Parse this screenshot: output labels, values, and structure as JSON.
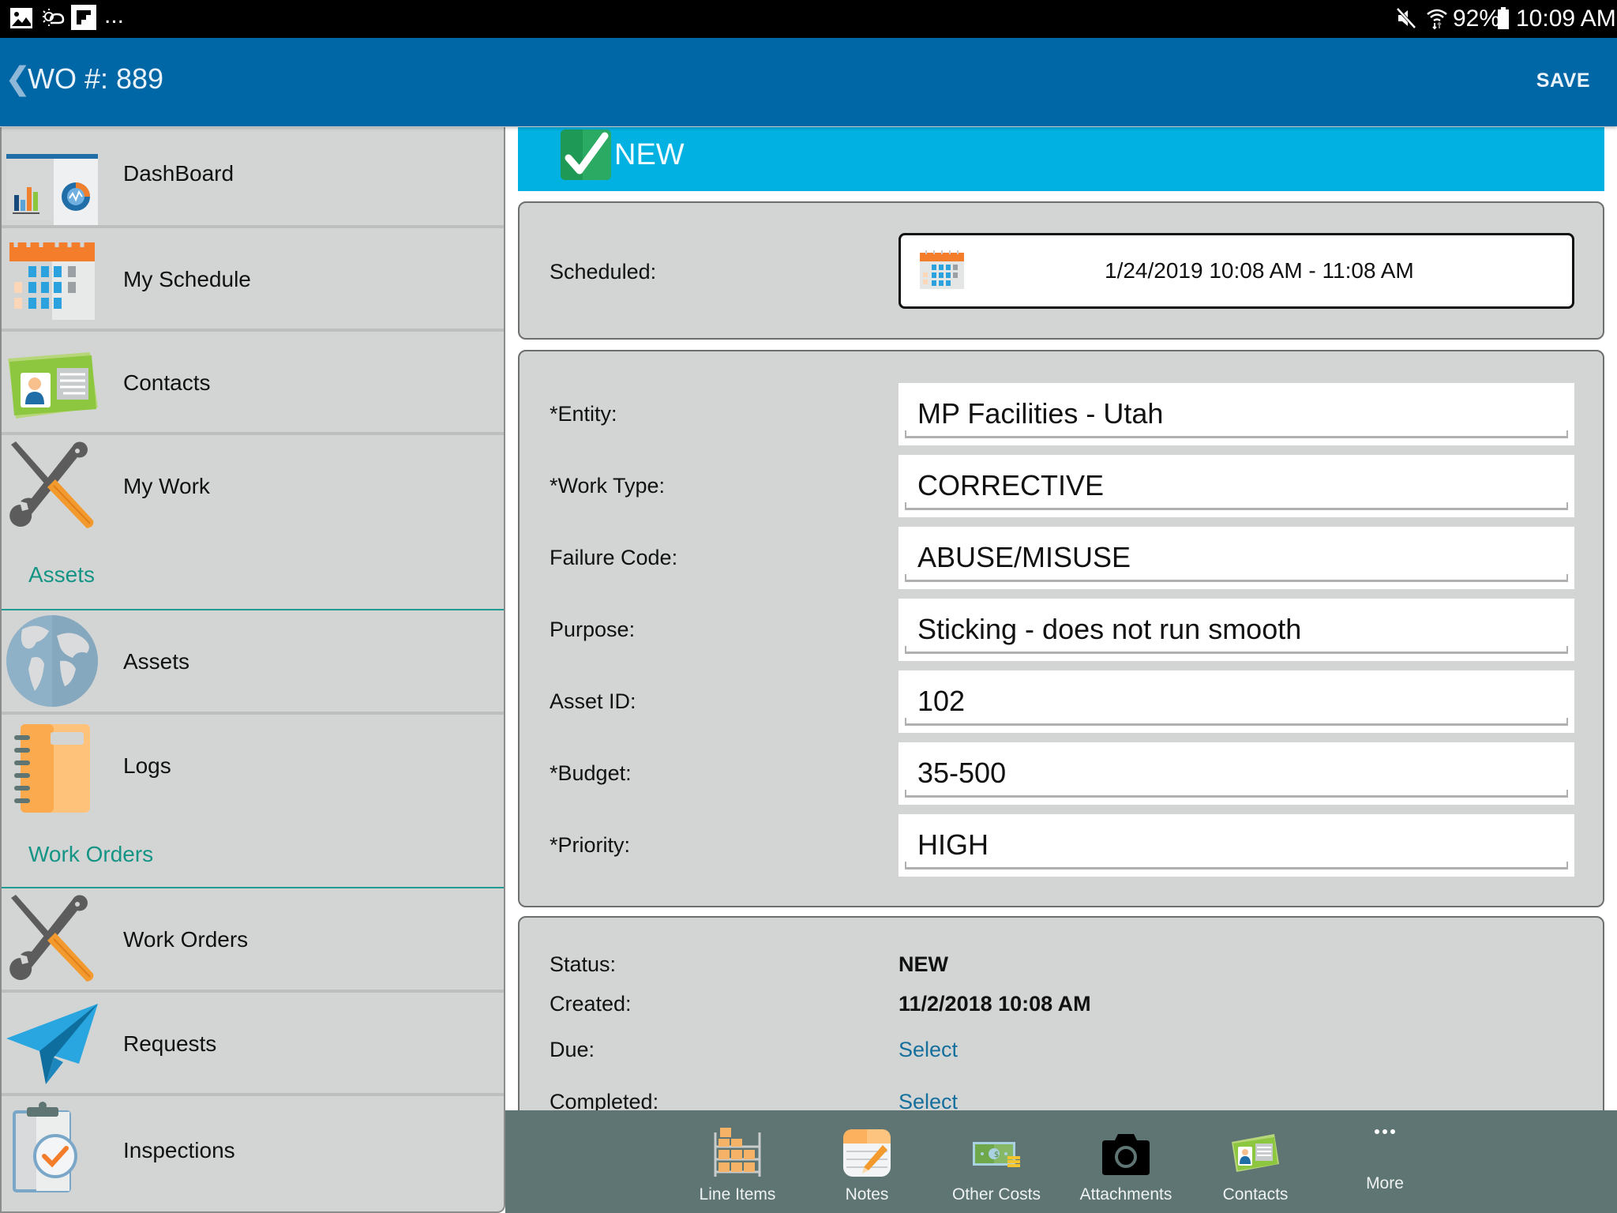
{
  "status_bar": {
    "left_icons": [
      "image-icon",
      "weather-icon",
      "flipboard-icon",
      "more-notifications-icon"
    ],
    "more_text": "...",
    "right_icons": [
      "mute-icon",
      "wifi-icon",
      "battery-icon"
    ],
    "battery": "92%",
    "time": "10:09 AM"
  },
  "header": {
    "back_glyph": "❮",
    "title": "WO #: 889",
    "save_label": "SAVE",
    "color": "#0067a7"
  },
  "sidebar": {
    "items": [
      {
        "label": "DashBoard",
        "icon": "dashboard-icon"
      },
      {
        "label": "My Schedule",
        "icon": "calendar-icon"
      },
      {
        "label": "Contacts",
        "icon": "contact-card-icon"
      },
      {
        "label": "My Work",
        "icon": "tools-icon"
      },
      {
        "label": "Assets",
        "icon": "globe-icon"
      },
      {
        "label": "Logs",
        "icon": "notebook-icon"
      },
      {
        "label": "Work Orders",
        "icon": "tools-icon"
      },
      {
        "label": "Requests",
        "icon": "paper-plane-icon"
      },
      {
        "label": "Inspections",
        "icon": "clipboard-check-icon"
      }
    ],
    "sections": [
      {
        "label": "Assets"
      },
      {
        "label": "Work Orders"
      }
    ],
    "section_color": "#139485"
  },
  "status_banner": {
    "label": "NEW",
    "color": "#00b1e1",
    "icon": "checkmark-icon"
  },
  "schedule": {
    "label": "Scheduled:",
    "value": "1/24/2019 10:08 AM - 11:08 AM"
  },
  "fields": [
    {
      "label": "*Entity:",
      "value": "MP Facilities - Utah"
    },
    {
      "label": "*Work Type:",
      "value": "CORRECTIVE"
    },
    {
      "label": "Failure Code:",
      "value": "ABUSE/MISUSE"
    },
    {
      "label": "Purpose:",
      "value": "Sticking - does not run smooth"
    },
    {
      "label": "Asset ID:",
      "value": "102"
    },
    {
      "label": "*Budget:",
      "value": "35-500"
    },
    {
      "label": "*Priority:",
      "value": "HIGH"
    }
  ],
  "info": {
    "status_label": "Status:",
    "status_value": "NEW",
    "created_label": "Created:",
    "created_value": "11/2/2018 10:08 AM",
    "due_label": "Due:",
    "due_value": "Select",
    "completed_label": "Completed:",
    "completed_value": "Select",
    "link_color": "#146f9c"
  },
  "toolbar": {
    "items": [
      {
        "label": "Line Items",
        "icon": "shelves-icon"
      },
      {
        "label": "Notes",
        "icon": "notepad-icon"
      },
      {
        "label": "Other Costs",
        "icon": "money-icon"
      },
      {
        "label": "Attachments",
        "icon": "camera-icon"
      },
      {
        "label": "Contacts",
        "icon": "contact-card-icon"
      },
      {
        "label": "More",
        "icon": "more-dots-icon"
      }
    ],
    "color": "#5f7573"
  }
}
